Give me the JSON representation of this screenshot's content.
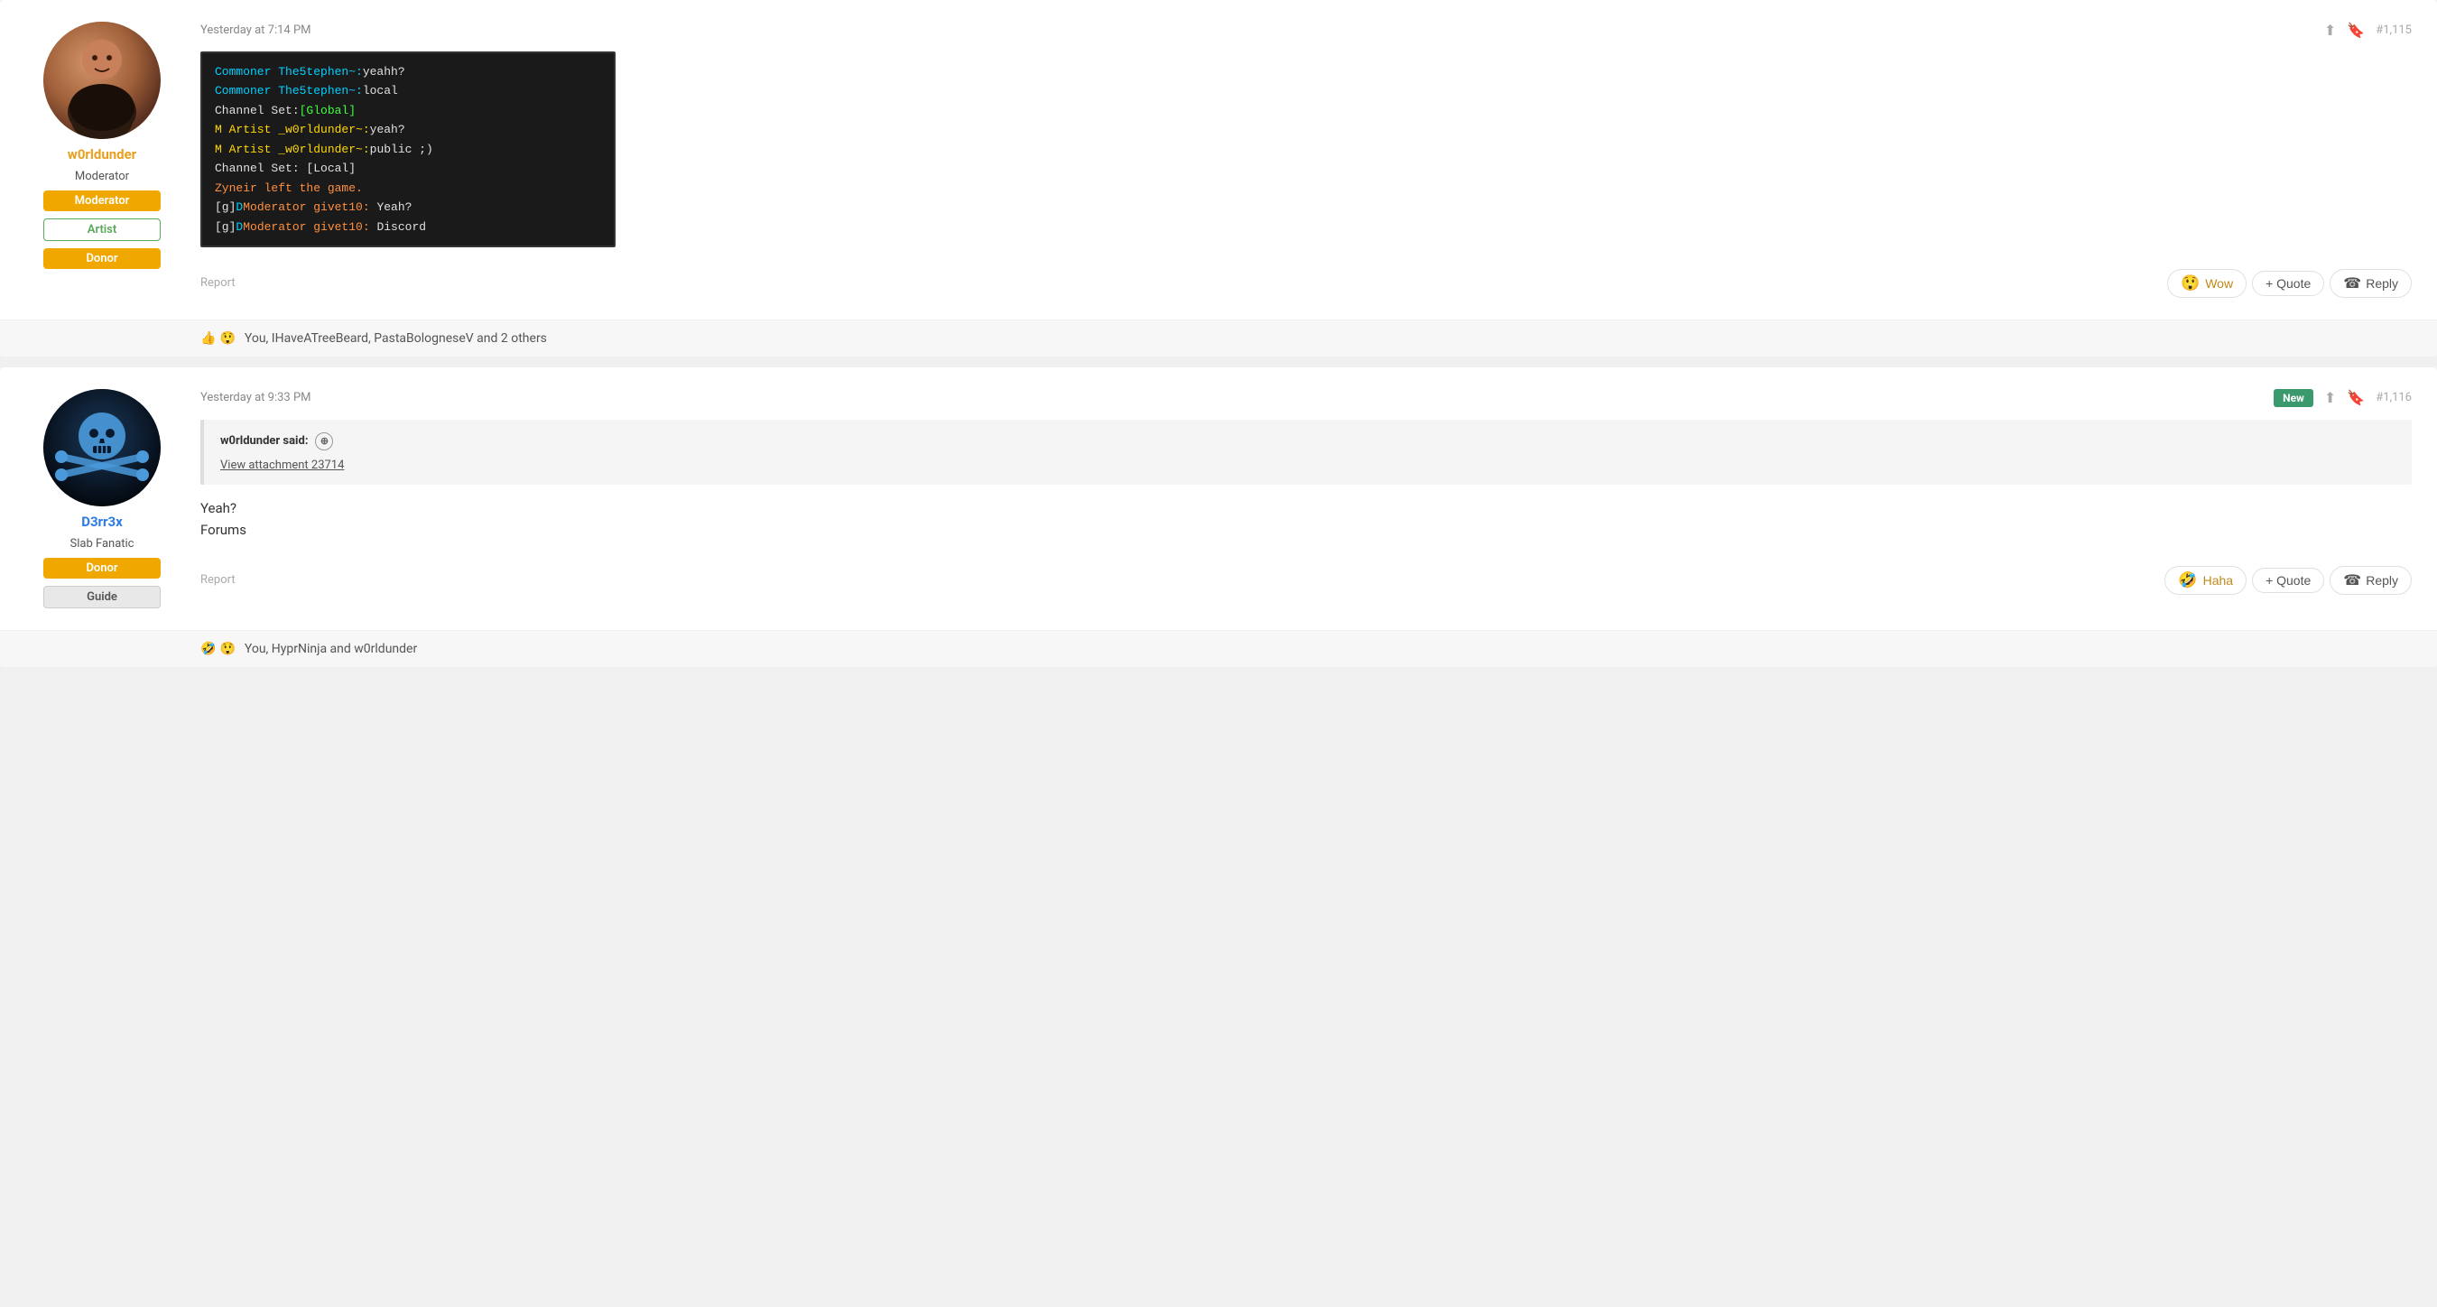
{
  "posts": [
    {
      "id": "post-1115",
      "number": "#1,115",
      "timestamp": "Yesterday at 7:14 PM",
      "user": {
        "username": "w0rldunder",
        "username_color": "orange",
        "title": "Moderator",
        "badges": [
          "Moderator",
          "Artist",
          "Donor"
        ],
        "badge_types": [
          "moderator",
          "artist",
          "donor"
        ]
      },
      "has_image": true,
      "game_lines": [
        {
          "parts": [
            {
              "text": "Commoner The5tephen~: ",
              "color": "cyan"
            },
            {
              "text": "yeahh?",
              "color": "white"
            }
          ]
        },
        {
          "parts": [
            {
              "text": "Commoner The5tephen~: ",
              "color": "cyan"
            },
            {
              "text": "local",
              "color": "white"
            }
          ]
        },
        {
          "parts": [
            {
              "text": "Channel Set: ",
              "color": "white"
            },
            {
              "text": "[Global]",
              "color": "green"
            }
          ]
        },
        {
          "parts": [
            {
              "text": "M Artist _w0rldunder~: ",
              "color": "yellow"
            },
            {
              "text": "yeah?",
              "color": "white"
            }
          ]
        },
        {
          "parts": [
            {
              "text": "M Artist _w0rldunder~: ",
              "color": "yellow"
            },
            {
              "text": "public ;)",
              "color": "white"
            }
          ]
        },
        {
          "parts": [
            {
              "text": "Channel Set: ",
              "color": "white"
            },
            {
              "text": "[Local]",
              "color": "white"
            }
          ]
        },
        {
          "parts": [
            {
              "text": "Zyneir left the game.",
              "color": "orange"
            }
          ]
        },
        {
          "parts": [
            {
              "text": "[g] ",
              "color": "white"
            },
            {
              "text": "D ",
              "color": "cyan"
            },
            {
              "text": "Moderator givet10: ",
              "color": "orange"
            },
            {
              "text": "Yeah?",
              "color": "white"
            }
          ]
        },
        {
          "parts": [
            {
              "text": "[g] ",
              "color": "white"
            },
            {
              "text": "D ",
              "color": "cyan"
            },
            {
              "text": "Moderator givet10: ",
              "color": "orange"
            },
            {
              "text": "Discord",
              "color": "white"
            }
          ]
        }
      ],
      "report_label": "Report",
      "reactions": {
        "wow_emoji": "😲",
        "wow_label": "Wow",
        "like_emoji": "👍",
        "wow_emoji2": "😲",
        "reaction_text": "You, IHaveATreeBeard, PastaBologneseV and 2 others"
      },
      "buttons": {
        "wow": "Wow",
        "quote": "+ Quote",
        "reply": "Reply"
      }
    },
    {
      "id": "post-1116",
      "number": "#1,116",
      "timestamp": "Yesterday at 9:33 PM",
      "is_new": true,
      "new_label": "New",
      "user": {
        "username": "D3rr3x",
        "username_color": "blue",
        "title": "Slab Fanatic",
        "badges": [
          "Donor",
          "Guide"
        ],
        "badge_types": [
          "donor",
          "guide"
        ]
      },
      "quote": {
        "author": "w0rldunder said:",
        "expand_icon": "⊕",
        "link": "View attachment 23714"
      },
      "body_lines": [
        "Yeah?",
        "Forums"
      ],
      "report_label": "Report",
      "reactions": {
        "haha_emoji": "🤣",
        "wow_emoji": "😲",
        "reaction_text": "You, HyprNinja and w0rldunder"
      },
      "buttons": {
        "haha": "Haha",
        "quote": "+ Quote",
        "reply": "Reply"
      }
    }
  ]
}
